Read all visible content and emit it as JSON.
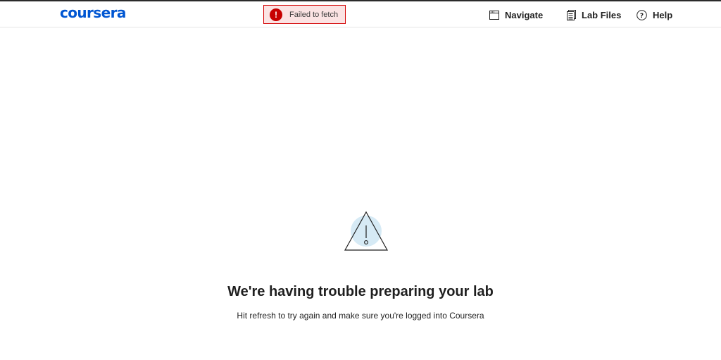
{
  "header": {
    "logo_text": "coursera",
    "toast": {
      "message": "Failed to fetch",
      "icon": "!"
    },
    "nav": [
      {
        "label": "Navigate",
        "icon": "window-icon"
      },
      {
        "label": "Lab Files",
        "icon": "files-icon"
      },
      {
        "label": "Help",
        "icon": "help-circle-icon"
      }
    ]
  },
  "error_state": {
    "title": "We're having trouble preparing your lab",
    "message": "Hit refresh to try again and make sure you're logged into Coursera"
  },
  "colors": {
    "brand": "#0056d2",
    "error": "#c70000",
    "error_bg": "#fbe3e3",
    "illustration_accent": "#d6eaf5"
  }
}
